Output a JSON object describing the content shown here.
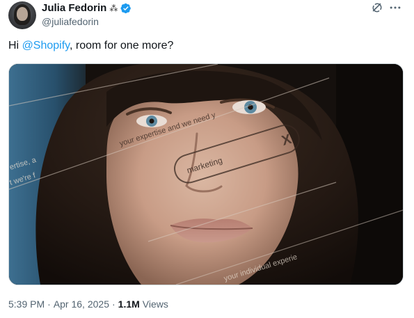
{
  "author": {
    "display_name": "Julia Fedorin",
    "name_emoji": "⁂",
    "handle": "@juliafedorin",
    "verified": true
  },
  "tweet": {
    "text_before": "Hi ",
    "mention": "@Shopify",
    "text_after": ", room for one more?"
  },
  "media": {
    "overlay_texts": [
      "your expertise and we need y",
      "ertise, a",
      "t we're f",
      "marketing",
      "your individual experie"
    ],
    "search_chip_close": "X"
  },
  "meta": {
    "time": "5:39 PM",
    "separator1": "·",
    "date": "Apr 16, 2025",
    "separator2": "·",
    "views_count": "1.1M",
    "views_label": "Views"
  },
  "icons": {
    "verified": "verified-badge-icon",
    "grok": "grok-icon",
    "more": "more-options-icon"
  },
  "colors": {
    "accent": "#1d9bf0",
    "text_primary": "#0f1419",
    "text_secondary": "#536471"
  }
}
